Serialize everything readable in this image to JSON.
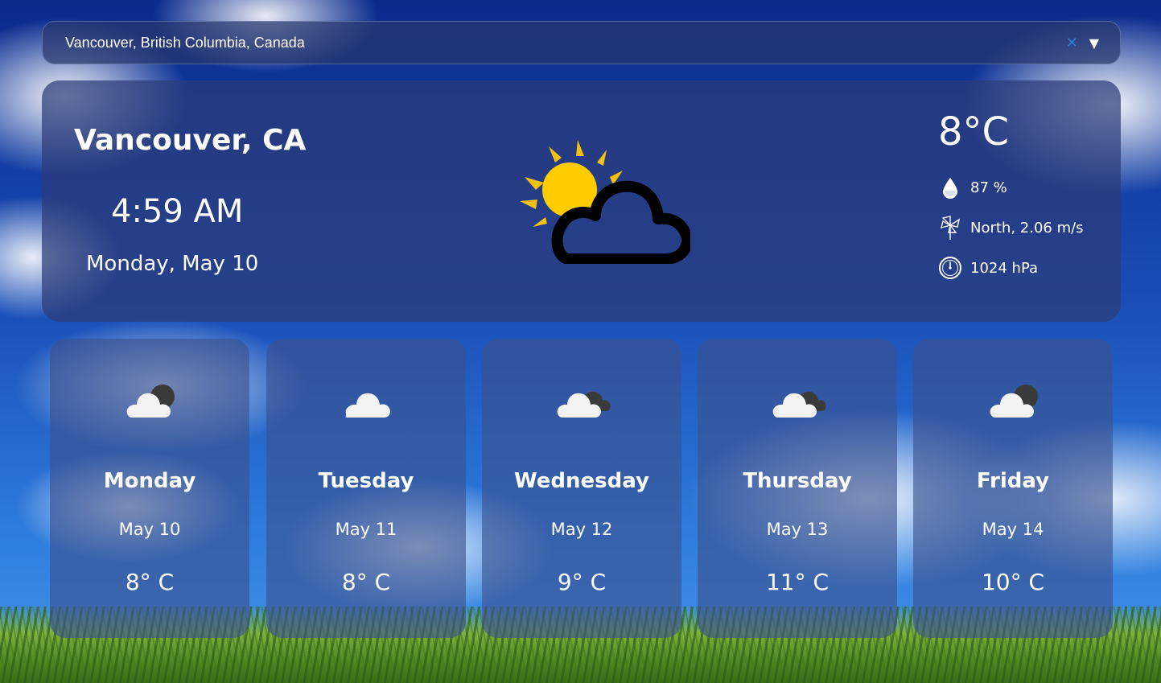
{
  "search": {
    "value": "Vancouver, British Columbia, Canada",
    "clear_icon": "close-icon",
    "dropdown_icon": "chevron-down-icon"
  },
  "current": {
    "city": "Vancouver, CA",
    "time": "4:59 AM",
    "date": "Monday, May 10",
    "condition_icon": "partly-cloudy-day-icon",
    "temperature": "8°C",
    "humidity": "87 %",
    "wind": "North, 2.06 m/s",
    "pressure": "1024 hPa"
  },
  "forecast": [
    {
      "day": "Monday",
      "date": "May 10",
      "temp": "8° C",
      "icon": "partly-cloudy-night-icon"
    },
    {
      "day": "Tuesday",
      "date": "May 11",
      "temp": "8° C",
      "icon": "cloud-icon"
    },
    {
      "day": "Wednesday",
      "date": "May 12",
      "temp": "9° C",
      "icon": "overcast-icon"
    },
    {
      "day": "Thursday",
      "date": "May 13",
      "temp": "11° C",
      "icon": "overcast-icon"
    },
    {
      "day": "Friday",
      "date": "May 14",
      "temp": "10° C",
      "icon": "partly-cloudy-night-icon"
    }
  ],
  "colors": {
    "sun": "#FFCC00",
    "sun_rays": "#F4C20D",
    "card_bg": "#2D3C78",
    "accent": "#2A7FD8"
  }
}
